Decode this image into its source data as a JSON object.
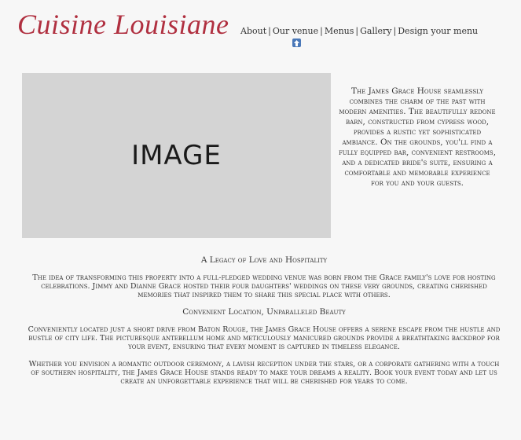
{
  "brand": {
    "logo_text": "Cuisine Louisiane"
  },
  "nav": {
    "items": [
      {
        "label": "About"
      },
      {
        "label": "Our venue"
      },
      {
        "label": "Menus"
      },
      {
        "label": "Gallery"
      },
      {
        "label": "Design your menu"
      }
    ],
    "separator": "|",
    "extra_icon": "arrow-up-icon"
  },
  "hero": {
    "image_placeholder": "IMAGE",
    "intro_text": "The James Grace House seamlessly combines the charm of the past with modern amenities. The beautifully redone barn, constructed from cypress wood, provides a rustic yet sophisticated ambiance. On the grounds, you'll find a fully equipped bar, convenient restrooms, and a dedicated bride's suite, ensuring a comfortable and memorable experience for you and your guests."
  },
  "sections": [
    {
      "heading": "A Legacy of Love and Hospitality",
      "body": "The idea of transforming this property into a full-fledged wedding venue was born from the Grace family's love for hosting celebrations. Jimmy and Dianne Grace hosted their four daughters' weddings on these very grounds, creating cherished memories that inspired them to share this special place with others."
    },
    {
      "heading": "Convenient Location, Unparalleled Beauty",
      "body": "Conveniently located just a short drive from Baton Rouge, the James Grace House offers a serene escape from the hustle and bustle of city life. The picturesque antebellum home and meticulously manicured grounds provide a breathtaking backdrop for your event, ensuring that every moment is captured in timeless elegance."
    },
    {
      "heading": "",
      "body": "Whether you envision a romantic outdoor ceremony, a lavish reception under the stars, or a corporate gathering with a touch of southern hospitality, the James Grace House stands ready to make your dreams a reality. Book your event today and let us create an unforgettable experience that will be cherished for years to come."
    }
  ],
  "colors": {
    "background": "#f7f7f7",
    "logo": "#b03040",
    "text": "#333333",
    "image_placeholder": "#d4d4d4",
    "icon": "#4a78b8"
  }
}
